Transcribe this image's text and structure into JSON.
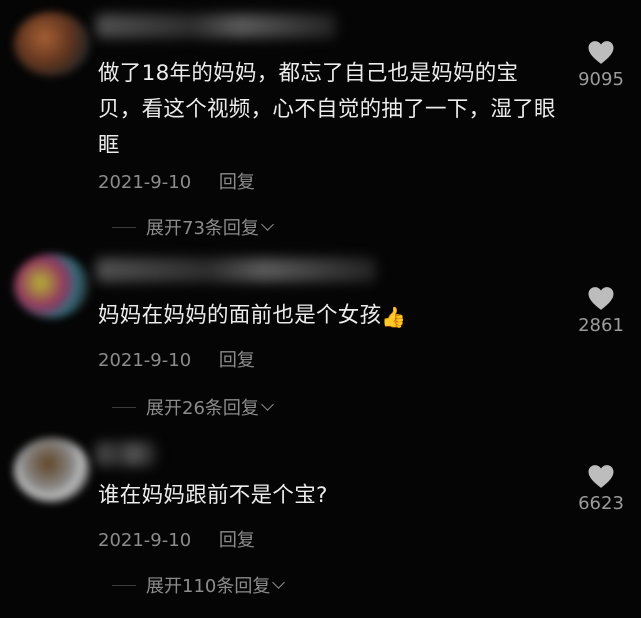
{
  "comments": [
    {
      "text": "做了18年的妈妈，都忘了自己也是妈妈的宝贝，看这个视频，心不自觉的抽了一下，湿了眼眶",
      "date": "2021-9-10",
      "reply_label": "回复",
      "expand_label": "展开73条回复",
      "likes": "9095"
    },
    {
      "text": "妈妈在妈妈的面前也是个女孩",
      "emoji": "👍",
      "date": "2021-9-10",
      "reply_label": "回复",
      "expand_label": "展开26条回复",
      "likes": "2861"
    },
    {
      "text": "谁在妈妈跟前不是个宝?",
      "date": "2021-9-10",
      "reply_label": "回复",
      "expand_label": "展开110条回复",
      "likes": "6623"
    }
  ],
  "icons": {
    "like": "heart-icon",
    "expand": "chevron-down-icon"
  },
  "colors": {
    "background": "#050505",
    "text": "#ececec",
    "meta": "#8c8c8c",
    "like_icon": "#bdbdbd"
  }
}
